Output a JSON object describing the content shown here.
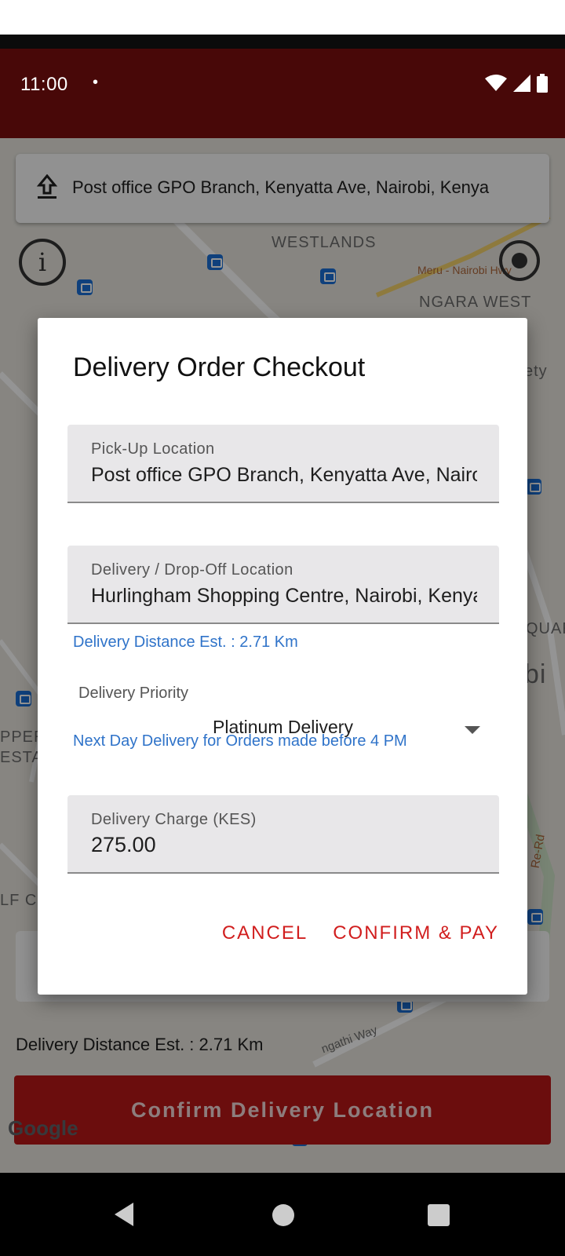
{
  "status_bar": {
    "time": "11:00",
    "notification_dot": "•",
    "icons": [
      "wifi-icon",
      "cell-signal-icon",
      "battery-icon"
    ]
  },
  "map": {
    "pickup_address": "Post office GPO Branch, Kenyatta Ave, Nairobi, Kenya",
    "labels": {
      "westlands": "WESTLANDS",
      "ngara_west": "NGARA WEST",
      "meru_nairobi": "Meru - Nairobi Hwy",
      "kiambu": "ety",
      "upper": "PPER",
      "esta": "ESTA",
      "lf": "LF C",
      "quar": "QUAR",
      "bi": "bi",
      "ngong": "ngathi Way",
      "road": "Re-Rd"
    },
    "delivery_distance": "Delivery Distance Est. : 2.71 Km",
    "confirm_button": "Confirm Delivery Location",
    "google_logo": "Google"
  },
  "dialog": {
    "title": "Delivery Order Checkout",
    "pickup": {
      "label": "Pick-Up Location",
      "value": "Post office GPO Branch, Kenyatta Ave, Nairobi, Kenya"
    },
    "dropoff": {
      "label": "Delivery / Drop-Off Location",
      "value": "Hurlingham Shopping Centre, Nairobi, Kenya"
    },
    "distance_text": "Delivery Distance Est. : 2.71 Km",
    "priority": {
      "label": "Delivery Priority",
      "selected": "Platinum Delivery",
      "note": "Next Day Delivery for Orders made before 4 PM"
    },
    "charge": {
      "label": "Delivery Charge (KES)",
      "value": "275.00"
    },
    "cancel": "CANCEL",
    "confirm": "CONFIRM & PAY"
  },
  "colors": {
    "status_bar": "#480808",
    "accent_red": "#d11e1e",
    "helper_blue": "#2f73c9",
    "confirm_button": "#b81818"
  }
}
